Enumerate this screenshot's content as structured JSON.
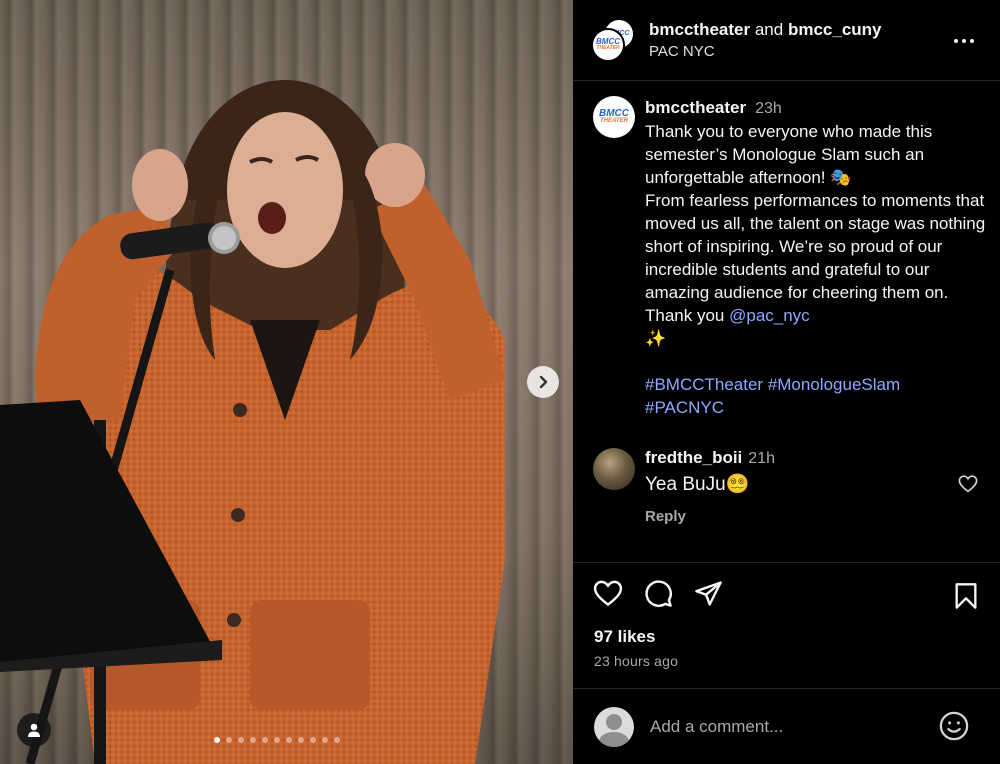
{
  "post": {
    "header": {
      "user1": "bmcctheater",
      "joiner": "and",
      "user2": "bmcc_cuny",
      "location": "PAC NYC"
    },
    "logo": {
      "line1": "BMCC",
      "line2": "THEATER"
    },
    "caption": {
      "username": "bmcctheater",
      "time": "23h",
      "text_main": "Thank you to everyone who made this semester’s Monologue Slam such an unforgettable afternoon! 🎭\nFrom fearless performances to moments that moved us all, the talent on stage was nothing short of inspiring. We’re so proud of our incredible students and grateful to our amazing audience for cheering them on. Thank you ",
      "mention": "@pac_nyc",
      "sparkle": "✨",
      "hashtags_line1": "#BMCCTheater #MonologueSlam",
      "hashtags_line2": "#PACNYC"
    },
    "comment": {
      "username": "fredthe_boii",
      "time": "21h",
      "text": "Yea BuJu😵‍💫",
      "reply_label": "Reply"
    },
    "likes": "97 likes",
    "posted_ago": "23 hours ago",
    "comment_placeholder": "Add a comment...",
    "carousel": {
      "total": 11,
      "active_index": 0
    }
  },
  "colors": {
    "background": "#000000",
    "link": "#8fa8ff",
    "muted": "#a8a8a8",
    "divider": "#262626",
    "cardigan": "#c9652f"
  },
  "icons": [
    "chevron-right-icon",
    "user-icon",
    "more-icon",
    "heart-icon",
    "comment-icon",
    "share-icon",
    "bookmark-icon",
    "emoji-icon"
  ]
}
